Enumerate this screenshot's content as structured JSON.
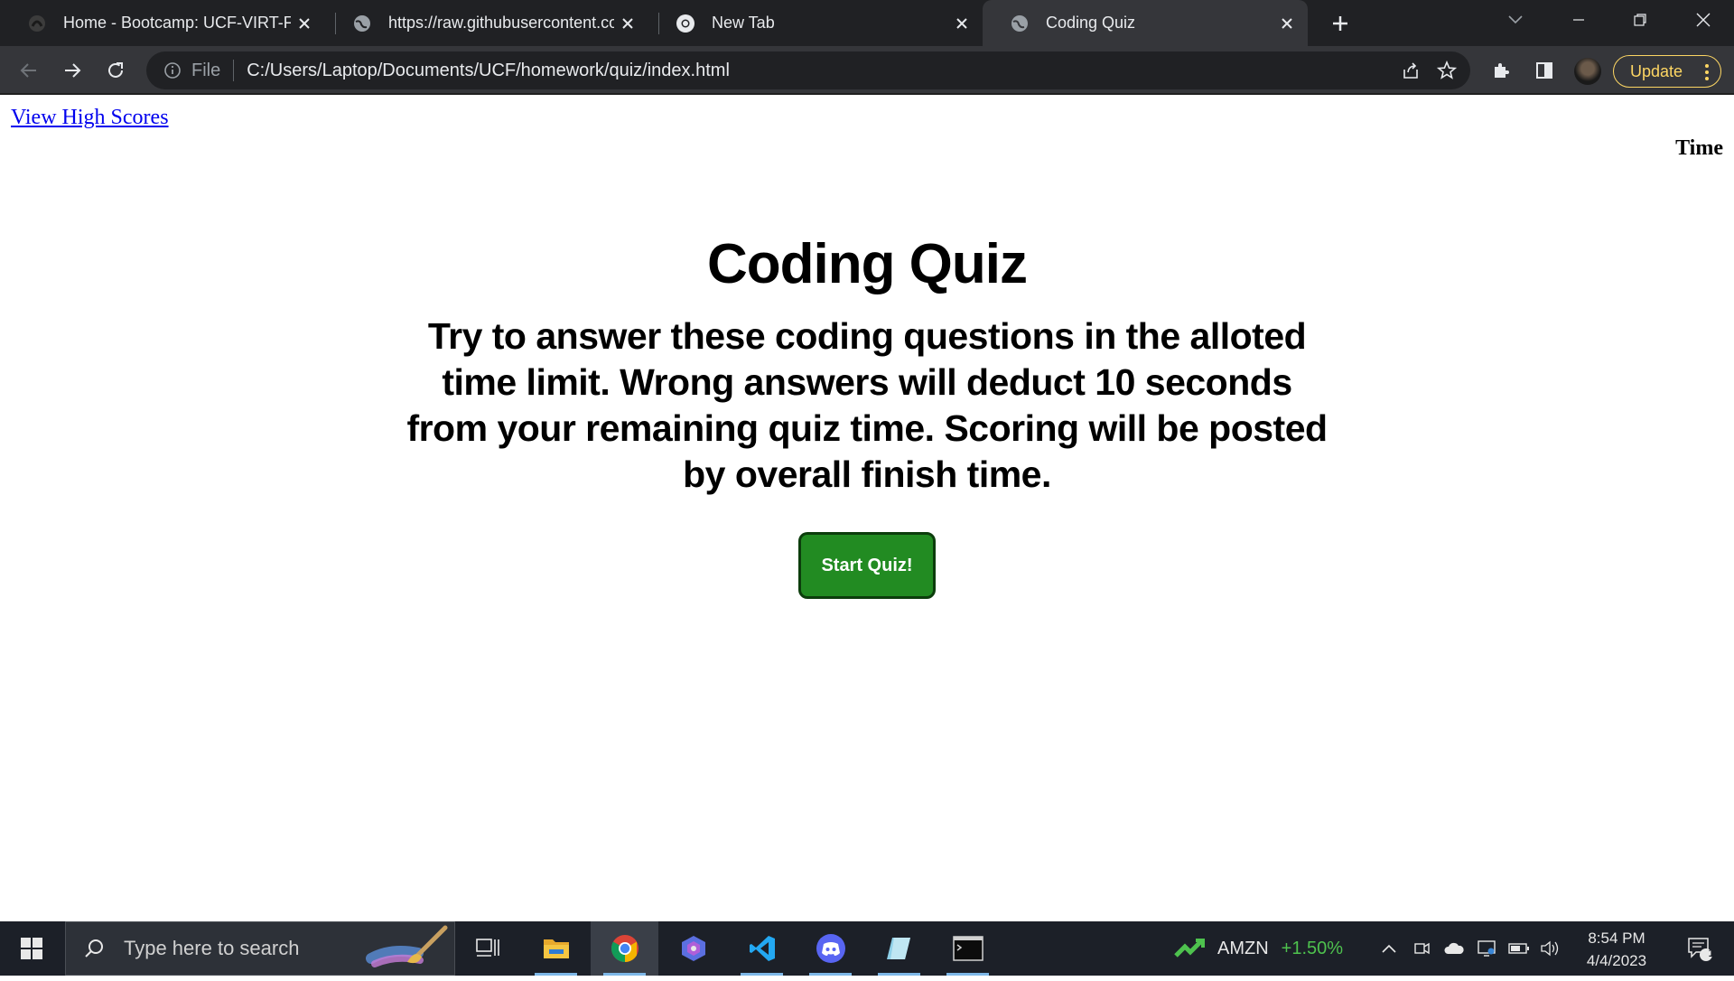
{
  "browser": {
    "tabs": [
      {
        "title": "Home - Bootcamp: UCF-VIRT-FSF",
        "favicon": "bootcamp-icon",
        "active": false
      },
      {
        "title": "https://raw.githubusercontent.co",
        "favicon": "globe-icon",
        "active": false
      },
      {
        "title": "New Tab",
        "favicon": "chrome-icon",
        "active": false
      },
      {
        "title": "Coding Quiz",
        "favicon": "globe-icon",
        "active": true
      }
    ],
    "omnibox": {
      "scheme_label": "File",
      "url": "C:/Users/Laptop/Documents/UCF/homework/quiz/index.html"
    },
    "update_label": "Update",
    "colors": {
      "tabstrip": "#202124",
      "toolbar": "#35363a",
      "update": "#fdd663"
    }
  },
  "page": {
    "high_scores_link": "View High Scores",
    "timer_label": "Time",
    "title": "Coding Quiz",
    "intro": "Try to answer these coding questions in the alloted time limit. Wrong answers will deduct 10 seconds from your remaining quiz time. Scoring will be posted by overall finish time.",
    "start_button": "Start Quiz!",
    "colors": {
      "start_button": "#228b22",
      "link": "#0000ee"
    }
  },
  "taskbar": {
    "search_placeholder": "Type here to search",
    "apps": [
      "task-view-icon",
      "file-explorer-icon",
      "chrome-icon",
      "copilot-icon",
      "vscode-icon",
      "discord-icon",
      "notepad-icon",
      "terminal-icon"
    ],
    "stock": {
      "ticker": "AMZN",
      "change": "+1.50%"
    },
    "time": "8:54 PM",
    "date": "4/4/2023",
    "notification_count": "1"
  }
}
